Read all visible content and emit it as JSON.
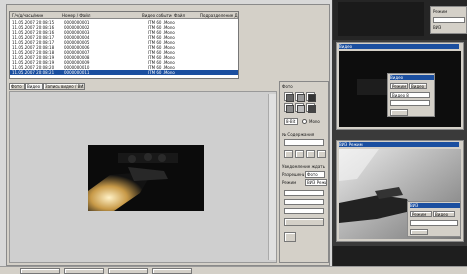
{
  "main": {
    "list": {
      "headers": [
        "Г/ч/д/часы/мин",
        "Номер / Файл",
        "Видео событие",
        "Файл",
        "Подразделение ДКУ"
      ],
      "rows": [
        {
          "time": "11.05.2007 20:08:15",
          "id": "0000000001",
          "file": "",
          "event": "ITM 60 .Mono",
          "selected": false
        },
        {
          "time": "11.05.2007 20:08:16",
          "id": "0000000002",
          "file": "",
          "event": "ITM 60 .Mono",
          "selected": false
        },
        {
          "time": "11.05.2007 20:08:16",
          "id": "0000000003",
          "file": "",
          "event": "ITM 60 .Mono",
          "selected": false
        },
        {
          "time": "11.05.2007 20:08:17",
          "id": "0000000004",
          "file": "",
          "event": "ITM 60 .Mono",
          "selected": false
        },
        {
          "time": "11.05.2007 20:08:17",
          "id": "0000000005",
          "file": "",
          "event": "ITM 60 .Mono",
          "selected": false
        },
        {
          "time": "11.05.2007 20:08:18",
          "id": "0000000006",
          "file": "",
          "event": "ITM 60 .Mono",
          "selected": false
        },
        {
          "time": "11.05.2007 20:08:18",
          "id": "0000000007",
          "file": "",
          "event": "ITM 60 .Mono",
          "selected": false
        },
        {
          "time": "11.05.2007 20:08:19",
          "id": "0000000008",
          "file": "",
          "event": "ITM 60 .Mono",
          "selected": false
        },
        {
          "time": "11.05.2007 20:08:19",
          "id": "0000000009",
          "file": "",
          "event": "ITM 60 .Mono",
          "selected": false
        },
        {
          "time": "11.05.2007 20:08:20",
          "id": "0000000010",
          "file": "",
          "event": "ITM 60 .Mono",
          "selected": false
        },
        {
          "time": "11.05.2007 20:08:21",
          "id": "0000000011",
          "file": "",
          "event": "ITM 60 .Mono",
          "selected": true
        }
      ]
    },
    "tabs": [
      "Фото",
      "Видео",
      "Запись видео / ВИЗ"
    ],
    "right_panel": {
      "title": "Фото",
      "dropdown": "8-Bit",
      "radio_label": "Mono",
      "section_1": "№ Содержания",
      "section_2": "Уведомление ждать",
      "section_3": "Разрешение",
      "section_4": "Режим",
      "value_1": "Фото",
      "value_2": "ВИЗ Режим"
    }
  },
  "right_windows": {
    "top_window": {
      "title": "Видео",
      "dialog_title": "Видео",
      "dialog_tab1": "Режим",
      "dialog_tab2": "Видео",
      "dialog_field": "Видео 8"
    },
    "bottom_window": {
      "title": "ВИЗ Режим",
      "dialog_title": "ВИЗ",
      "dialog_tab1": "Режим",
      "dialog_tab2": "Видео"
    }
  },
  "top_right_panel": {
    "label1": "Режим",
    "label2": "ВИЗ"
  },
  "taskbar": {
    "items": [
      "",
      "",
      "",
      ""
    ]
  }
}
